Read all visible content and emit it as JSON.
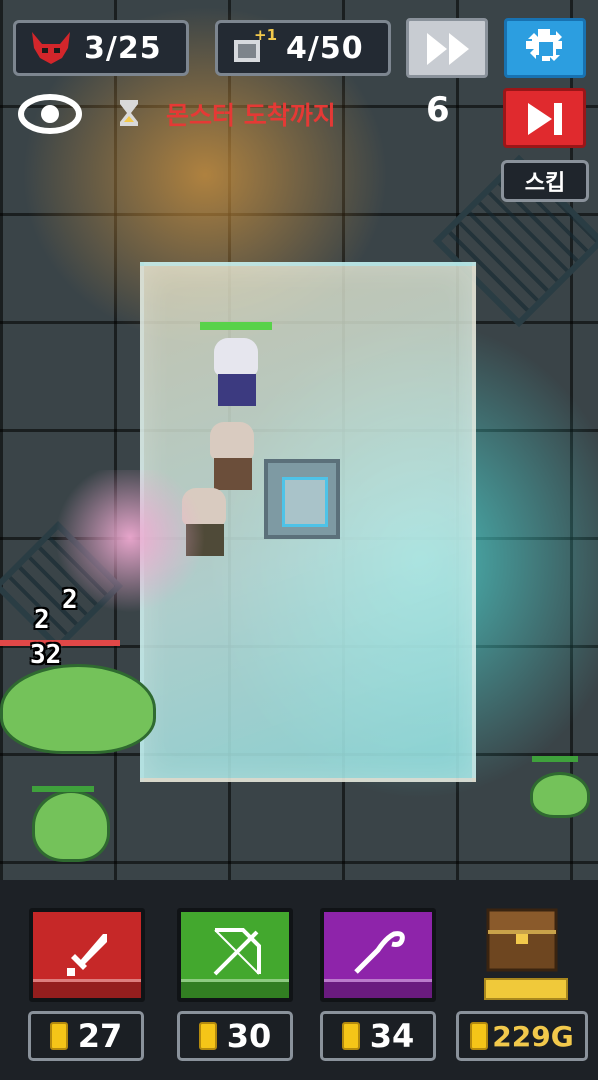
{
  "hud": {
    "monsters": {
      "icon": "demon-horns-icon",
      "value": "3/25"
    },
    "upgrades": {
      "icon": "upgrade-plus-one-icon",
      "badge": "+1",
      "value": "4/50"
    },
    "buttons": {
      "fast_forward": {
        "icon": "fast-forward-icon"
      },
      "settings": {
        "icon": "gear-icon"
      },
      "skip_wave": {
        "icon": "skip-next-icon",
        "label": "스킵"
      }
    },
    "wave": {
      "label": "몬스터 도착까지",
      "countdown": "6"
    }
  },
  "battle": {
    "damage_numbers": [
      "2",
      "2",
      "32"
    ]
  },
  "shop": {
    "units": [
      {
        "name": "sword",
        "icon": "sword-icon",
        "color": "#c62828",
        "cost": "27"
      },
      {
        "name": "bow",
        "icon": "bow-icon",
        "color": "#43a82e",
        "cost": "30"
      },
      {
        "name": "staff",
        "icon": "staff-icon",
        "color": "#8e24aa",
        "cost": "34"
      }
    ],
    "treasure": {
      "icon": "treasure-chest-icon",
      "gold": "229G"
    }
  }
}
